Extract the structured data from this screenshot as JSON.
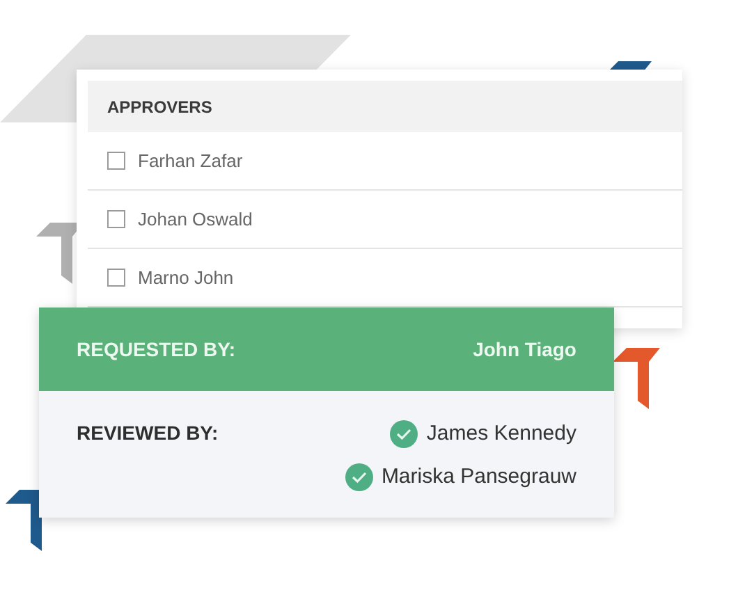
{
  "approvers": {
    "title": "APPROVERS",
    "items": [
      {
        "name": "Farhan Zafar",
        "checked": false
      },
      {
        "name": "Johan Oswald",
        "checked": false
      },
      {
        "name": "Marno John",
        "checked": false
      }
    ]
  },
  "requested_by": {
    "label": "REQUESTED BY:",
    "name": "John Tiago"
  },
  "reviewed_by": {
    "label": "REVIEWED BY:",
    "reviewers": [
      {
        "name": "James Kennedy",
        "approved": true
      },
      {
        "name": "Mariska Pansegrauw",
        "approved": true
      }
    ]
  }
}
